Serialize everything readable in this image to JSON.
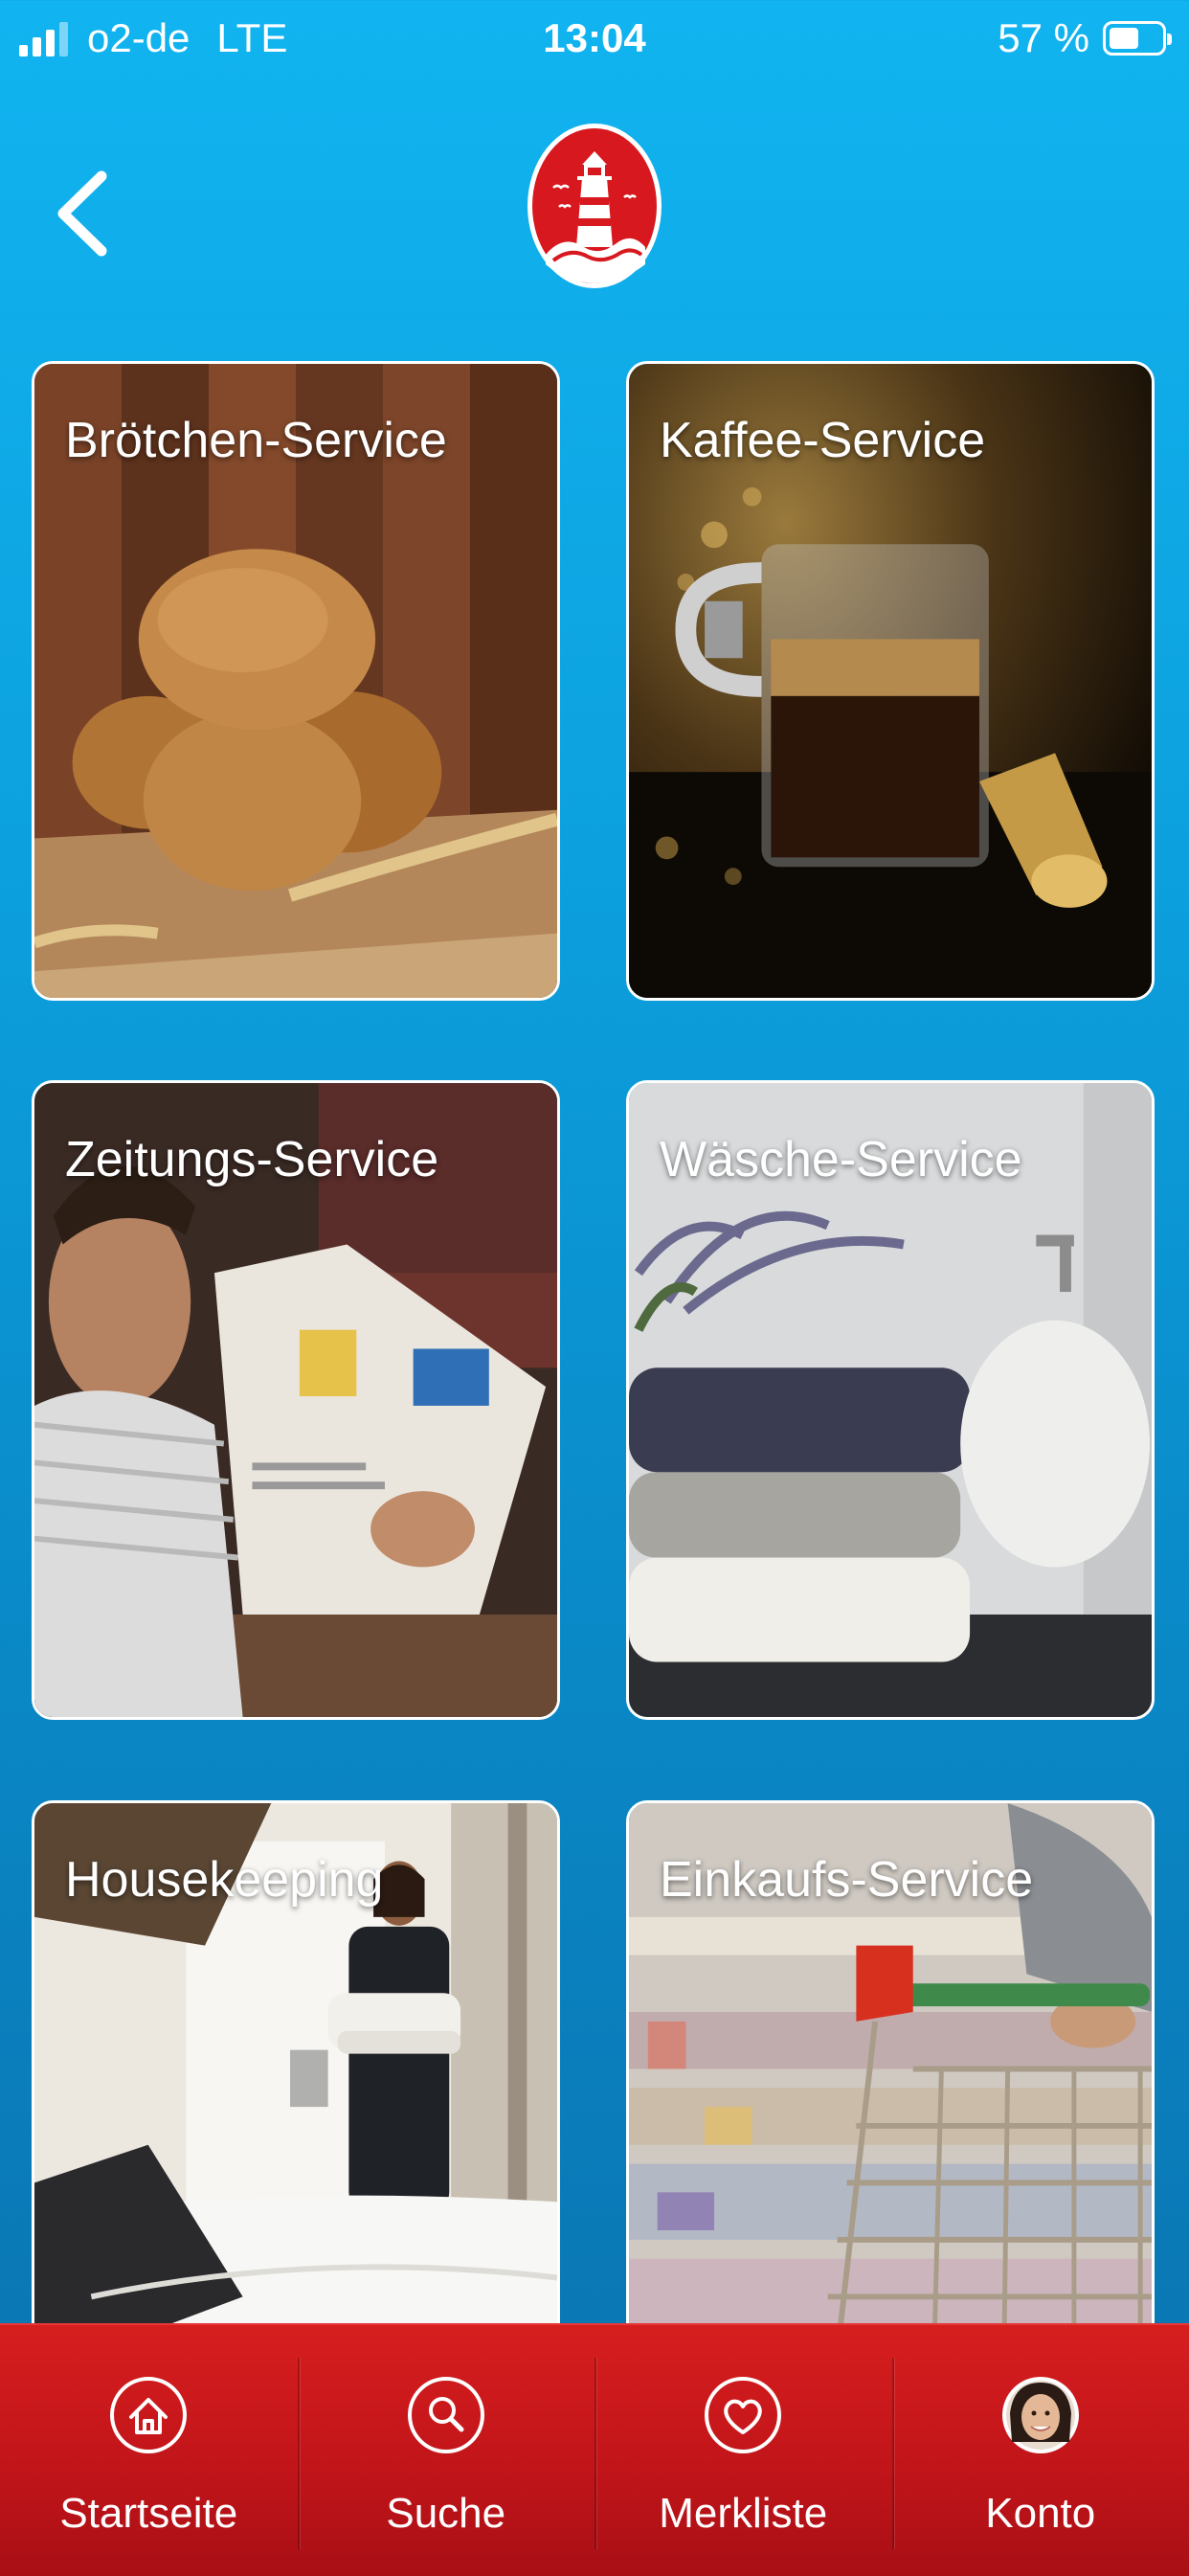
{
  "status_bar": {
    "carrier": "o2-de",
    "network": "LTE",
    "time": "13:04",
    "battery_text": "57 %",
    "battery_level": 0.57
  },
  "header": {
    "back_icon": "chevron-left-icon",
    "logo_icon": "lighthouse-logo"
  },
  "services": [
    {
      "title": "Brötchen-Service",
      "image": "bread-rolls-photo"
    },
    {
      "title": "Kaffee-Service",
      "image": "coffee-cup-photo"
    },
    {
      "title": "Zeitungs-Service",
      "image": "man-reading-newspaper-photo"
    },
    {
      "title": "Wäsche-Service",
      "image": "towels-lavender-photo"
    },
    {
      "title": "Housekeeping",
      "image": "housekeeper-photo"
    },
    {
      "title": "Einkaufs-Service",
      "image": "shopping-cart-photo"
    }
  ],
  "tab_bar": {
    "items": [
      {
        "label": "Startseite",
        "icon": "home-icon"
      },
      {
        "label": "Suche",
        "icon": "search-icon"
      },
      {
        "label": "Merkliste",
        "icon": "heart-icon"
      },
      {
        "label": "Konto",
        "icon": "avatar"
      }
    ]
  },
  "colors": {
    "background": "#0c9fdd",
    "tab_bar": "#c2151a",
    "logo_red": "#d7191f"
  }
}
